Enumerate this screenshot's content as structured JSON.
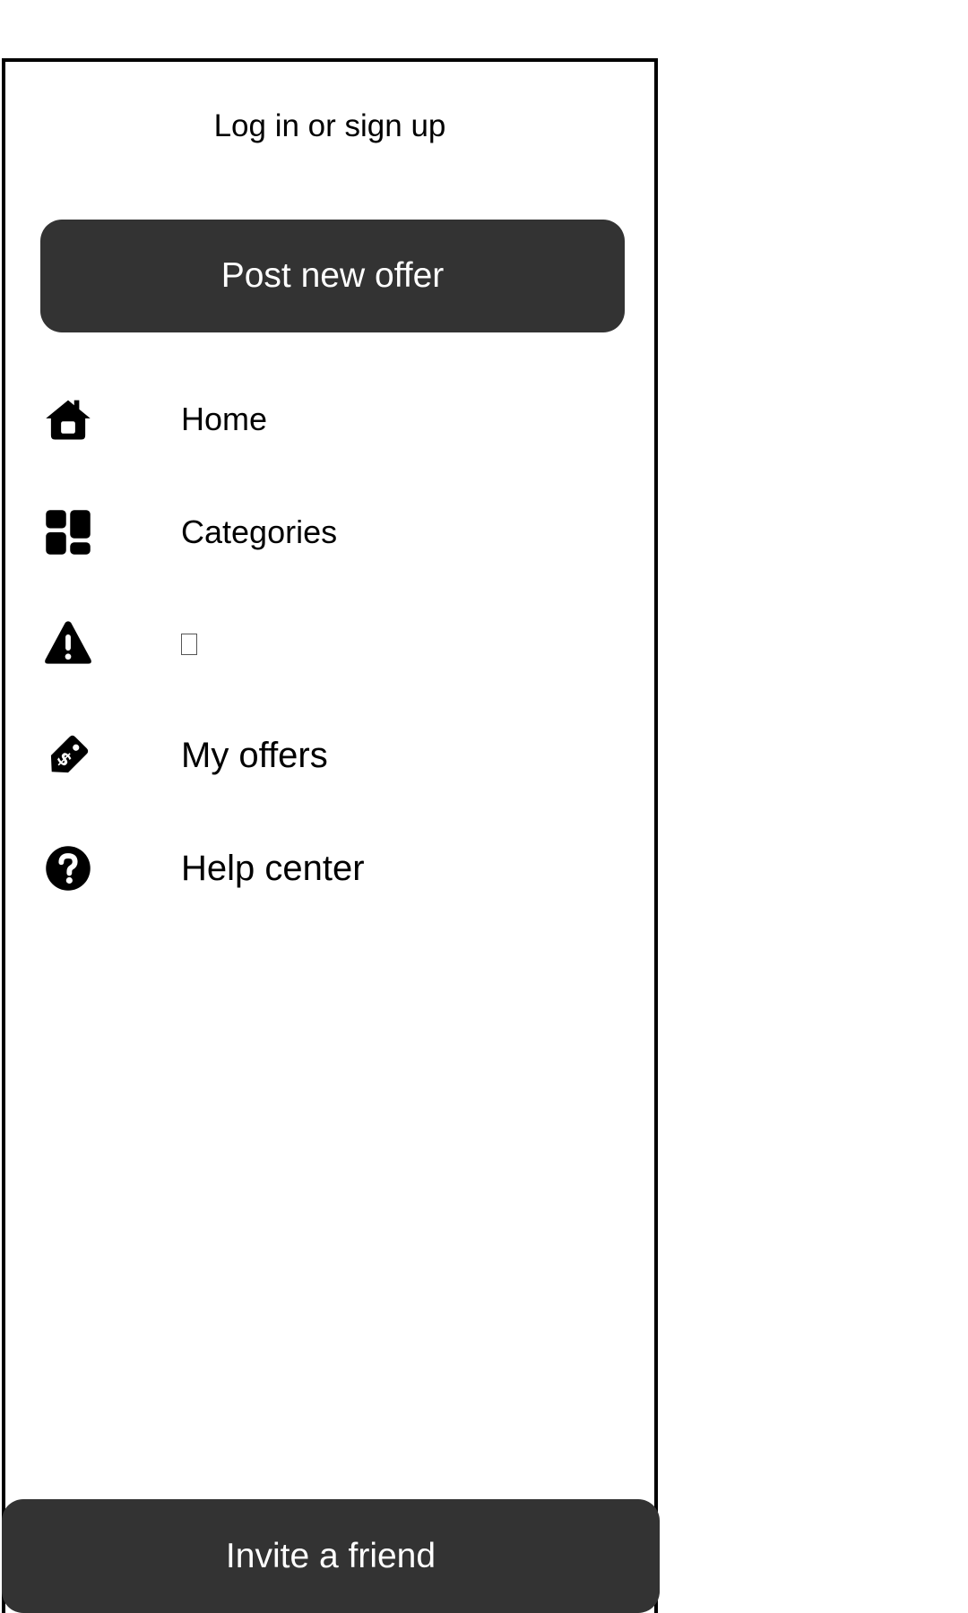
{
  "drawer": {
    "login_label": "Log in or sign up",
    "post_offer_label": "Post new offer",
    "menu": [
      {
        "label": "Home",
        "icon": "home-icon"
      },
      {
        "label": "Categories",
        "icon": "dashboard-icon"
      },
      {
        "label": "",
        "icon": "warning-icon",
        "missing_glyph": true
      },
      {
        "label": "My offers",
        "icon": "price-tag-icon"
      },
      {
        "label": "Help center",
        "icon": "help-circle-icon"
      }
    ],
    "invite_label": "Invite a friend"
  },
  "colors": {
    "button_bg": "#333333",
    "button_text": "#ffffff",
    "text": "#000000",
    "border": "#000000"
  }
}
